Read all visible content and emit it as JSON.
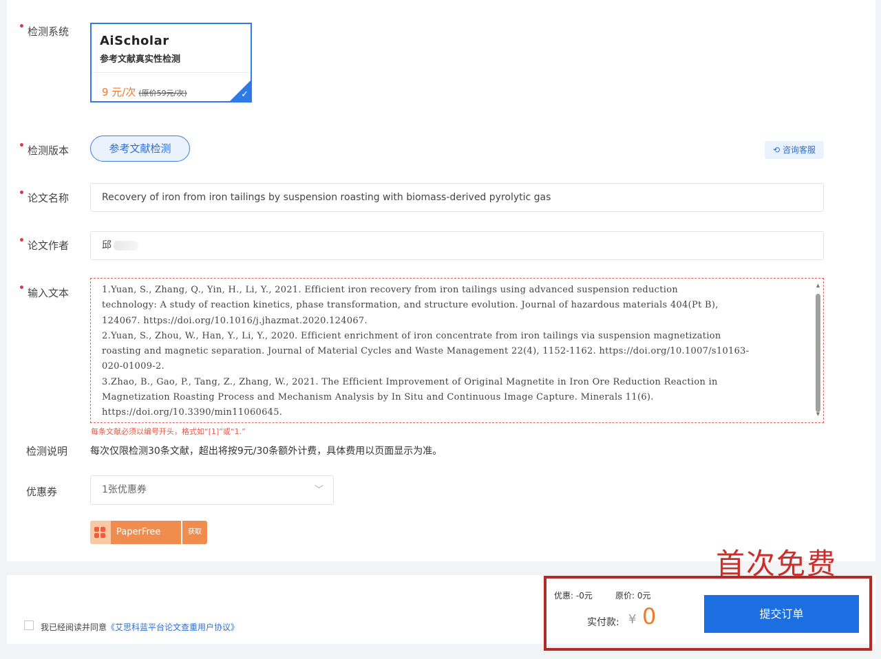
{
  "form": {
    "system_label": "检测系统",
    "version_label": "检测版本",
    "title_label": "论文名称",
    "author_label": "论文作者",
    "text_label": "输入文本",
    "desc_label": "检测说明",
    "coupon_label": "优惠券"
  },
  "card": {
    "brand": "AiScholar",
    "subtitle": "参考文献真实性检测",
    "price": "9 元/次",
    "original_price": "(原价59元/次)"
  },
  "version": {
    "selected": "参考文献检测"
  },
  "help_button": "咨询客服",
  "paper_title": "Recovery of iron from iron tailings by suspension roasting with biomass-derived pyrolytic gas",
  "paper_author": "邱",
  "references_text": "1.Yuan, S., Zhang, Q., Yin, H., Li, Y., 2021. Efficient iron recovery from iron tailings using advanced suspension reduction\ntechnology: A study of reaction kinetics, phase transformation, and structure evolution. Journal of hazardous materials 404(Pt B),\n124067. https://doi.org/10.1016/j.jhazmat.2020.124067.\n2.Yuan, S., Zhou, W., Han, Y., Li, Y., 2020. Efficient enrichment of iron concentrate from iron tailings via suspension magnetization\nroasting and magnetic separation. Journal of Material Cycles and Waste Management 22(4), 1152-1162. https://doi.org/10.1007/s10163-\n020-01009-2.\n3.Zhao, B., Gao, P., Tang, Z., Zhang, W., 2021. The Efficient Improvement of Original Magnetite in Iron Ore Reduction Reaction in\nMagnetization Roasting Process and Mechanism Analysis by In Situ and Continuous Image Capture. Minerals 11(6).\nhttps://doi.org/10.3390/min11060645.",
  "hint": "每条文献必须以编号开头，格式如“[1]”或“1.”",
  "description": "每次仅限检测30条文献，超出将按9元/30条额外计费，具体费用以页面显示为准。",
  "coupon": {
    "selected": "1张优惠券"
  },
  "paperfree": {
    "label": "PaperFree",
    "get": "获取"
  },
  "agreement": {
    "text": "我已经阅读并同意",
    "link": "《艾思科蓝平台论文查重用户协议》"
  },
  "promo": "首次免费",
  "summary": {
    "discount": "优惠: -0元",
    "original": "原价: 0元",
    "pay_label": "实付款:",
    "currency": "¥",
    "amount": "0",
    "submit": "提交订单"
  },
  "colors": {
    "accent": "#1c6fe0",
    "price": "#f07a2a",
    "promo": "#c9302c"
  }
}
